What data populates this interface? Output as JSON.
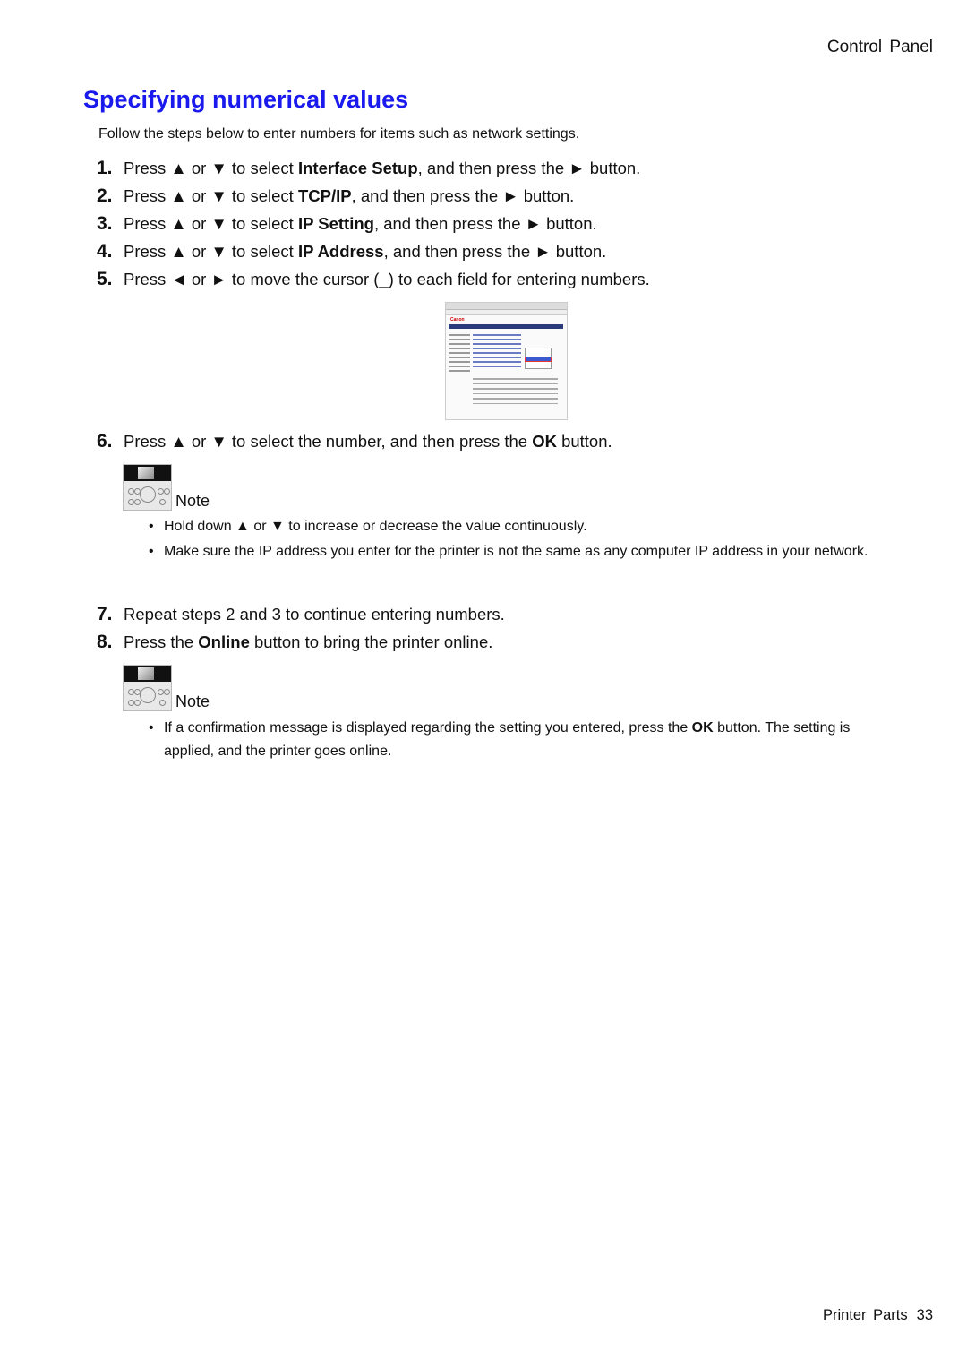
{
  "header": {
    "section": "Control Panel"
  },
  "title": "Specifying numerical values",
  "intro": "Follow the steps below to enter numbers for items such as network settings.",
  "steps": [
    {
      "num": "1.",
      "pre": "Press ▲ or ▼ to select ",
      "bold": "Interface Setup",
      "post": ", and then press the ► button."
    },
    {
      "num": "2.",
      "pre": "Press ▲ or ▼ to select ",
      "bold": "TCP/IP",
      "post": ", and then press the ► button."
    },
    {
      "num": "3.",
      "pre": "Press ▲ or ▼ to select ",
      "bold": "IP Setting",
      "post": ", and then press the ► button."
    },
    {
      "num": "4.",
      "pre": "Press ▲ or ▼ to select ",
      "bold": "IP Address",
      "post": ", and then press the ► button."
    },
    {
      "num": "5.",
      "pre": "Press ◄ or ► to move the cursor (_) to each field for entering numbers.",
      "bold": "",
      "post": ""
    },
    {
      "num": "6.",
      "pre": "Press ▲ or ▼ to select the number, and then press the ",
      "bold": "OK",
      "post": " button."
    },
    {
      "num": "7.",
      "pre": "Repeat steps 2 and 3 to continue entering numbers.",
      "bold": "",
      "post": ""
    },
    {
      "num": "8.",
      "pre": "Press the ",
      "bold": "Online",
      "post": " button to bring the printer online."
    }
  ],
  "screenshot": {
    "logo": "Canon"
  },
  "notes": [
    {
      "label": "Note",
      "bullets": [
        {
          "pre": "Hold down ▲ or ▼ to increase or decrease the value continuously.",
          "bold": "",
          "post": ""
        },
        {
          "pre": "Make sure the IP address you enter for the printer is not the same as any computer IP address in your network.",
          "bold": "",
          "post": ""
        }
      ]
    },
    {
      "label": "Note",
      "bullets": [
        {
          "pre": "If a confirmation message is displayed regarding the setting you entered, press the ",
          "bold": "OK",
          "post": " button.  The setting is applied, and the printer goes online."
        }
      ]
    }
  ],
  "footer": {
    "section": "Printer Parts",
    "page": "33"
  },
  "colors": {
    "heading": "#1a1aee"
  }
}
